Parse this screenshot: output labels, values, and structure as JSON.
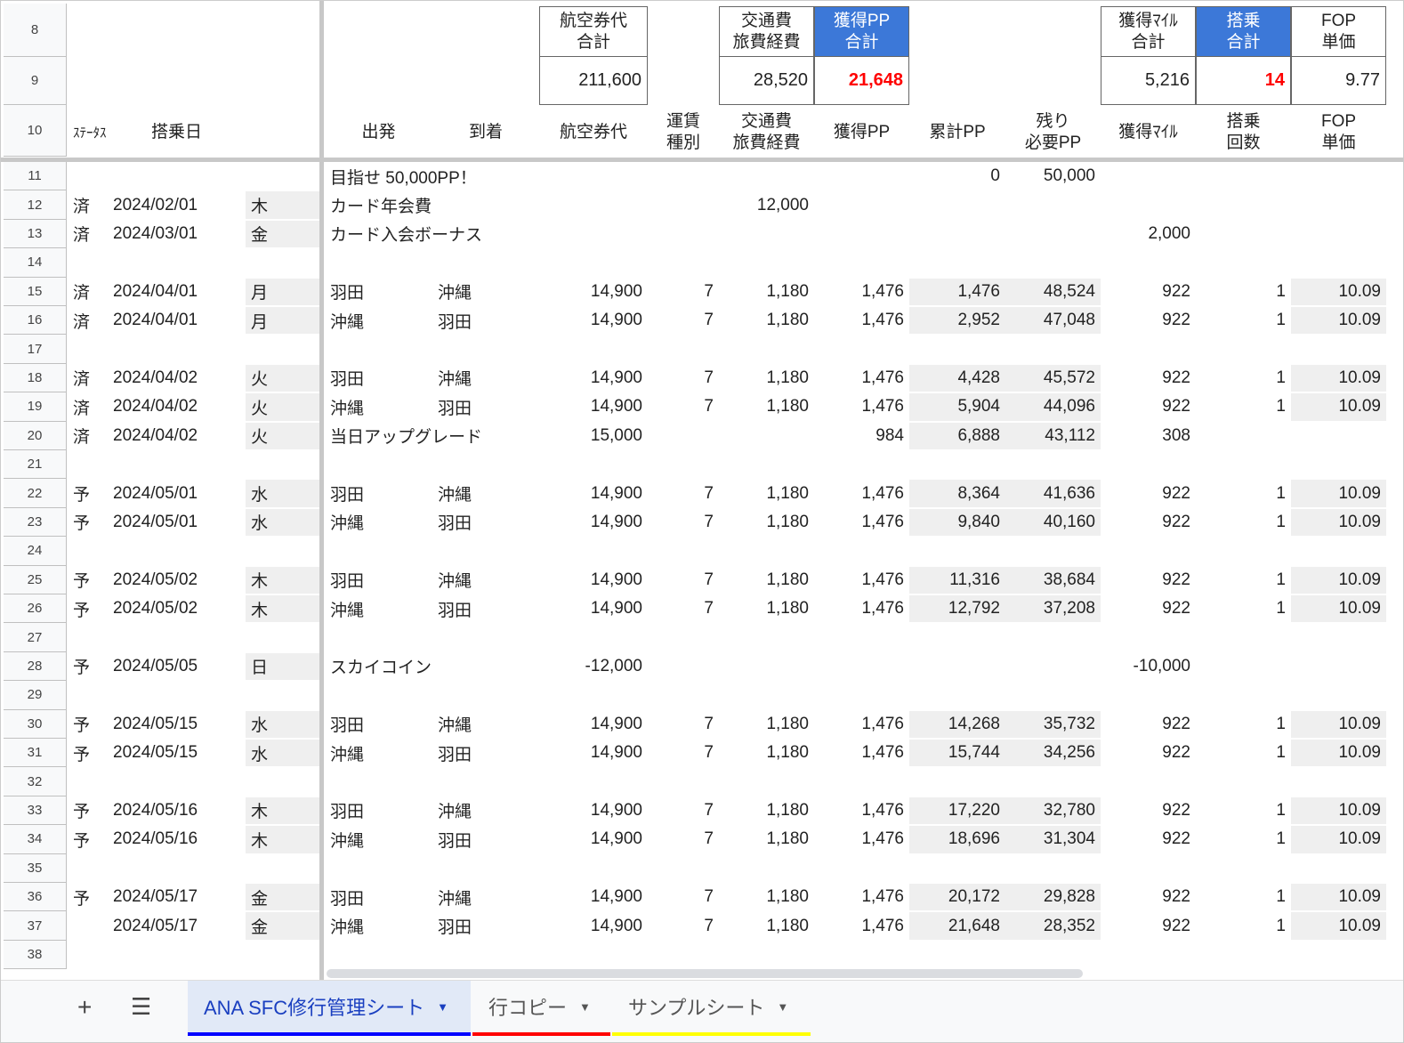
{
  "summary": {
    "fare_total": {
      "label": "航空券代\n合計",
      "value": "211,600"
    },
    "transport_total": {
      "label": "交通費\n旅費経費",
      "value": "28,520"
    },
    "pp_total": {
      "label": "獲得PP\n合計",
      "value": "21,648"
    },
    "miles_total": {
      "label": "獲得ﾏｲﾙ\n合計",
      "value": "5,216"
    },
    "boarding_total": {
      "label": "搭乗\n合計",
      "value": "14"
    },
    "fop_unit": {
      "label": "FOP\n単価",
      "value": "9.77"
    }
  },
  "headers": {
    "status": "ｽﾃｰﾀｽ",
    "date": "搭乗日",
    "dep": "出発",
    "arr": "到着",
    "fare": "航空券代",
    "type": "運賃\n種別",
    "transport": "交通費\n旅費経費",
    "pp": "獲得PP",
    "cum": "累計PP",
    "remain": "残り\n必要PP",
    "miles": "獲得ﾏｲﾙ",
    "count": "搭乗\n回数",
    "fop": "FOP\n単価"
  },
  "header_row_numbers": [
    "8",
    "9",
    "10"
  ],
  "rows": [
    {
      "n": "11",
      "dep": "目指せ 50,000PP！",
      "cum": "0",
      "remain": "50,000"
    },
    {
      "n": "12",
      "status": "済",
      "date": "2024/02/01",
      "dow": "木",
      "dep": "カード年会費",
      "transport": "12,000"
    },
    {
      "n": "13",
      "status": "済",
      "date": "2024/03/01",
      "dow": "金",
      "dep": "カード入会ボーナス",
      "miles": "2,000"
    },
    {
      "n": "14"
    },
    {
      "n": "15",
      "status": "済",
      "date": "2024/04/01",
      "dow": "月",
      "dep": "羽田",
      "arr": "沖縄",
      "fare": "14,900",
      "type": "7",
      "transport": "1,180",
      "pp": "1,476",
      "cum": "1,476",
      "remain": "48,524",
      "miles": "922",
      "count": "1",
      "fop": "10.09"
    },
    {
      "n": "16",
      "status": "済",
      "date": "2024/04/01",
      "dow": "月",
      "dep": "沖縄",
      "arr": "羽田",
      "fare": "14,900",
      "type": "7",
      "transport": "1,180",
      "pp": "1,476",
      "cum": "2,952",
      "remain": "47,048",
      "miles": "922",
      "count": "1",
      "fop": "10.09"
    },
    {
      "n": "17"
    },
    {
      "n": "18",
      "status": "済",
      "date": "2024/04/02",
      "dow": "火",
      "dep": "羽田",
      "arr": "沖縄",
      "fare": "14,900",
      "type": "7",
      "transport": "1,180",
      "pp": "1,476",
      "cum": "4,428",
      "remain": "45,572",
      "miles": "922",
      "count": "1",
      "fop": "10.09"
    },
    {
      "n": "19",
      "status": "済",
      "date": "2024/04/02",
      "dow": "火",
      "dep": "沖縄",
      "arr": "羽田",
      "fare": "14,900",
      "type": "7",
      "transport": "1,180",
      "pp": "1,476",
      "cum": "5,904",
      "remain": "44,096",
      "miles": "922",
      "count": "1",
      "fop": "10.09"
    },
    {
      "n": "20",
      "status": "済",
      "date": "2024/04/02",
      "dow": "火",
      "dep": "当日アップグレード",
      "fare": "15,000",
      "pp": "984",
      "cum": "6,888",
      "remain": "43,112",
      "miles": "308"
    },
    {
      "n": "21"
    },
    {
      "n": "22",
      "status": "予",
      "date": "2024/05/01",
      "dow": "水",
      "dep": "羽田",
      "arr": "沖縄",
      "fare": "14,900",
      "type": "7",
      "transport": "1,180",
      "pp": "1,476",
      "cum": "8,364",
      "remain": "41,636",
      "miles": "922",
      "count": "1",
      "fop": "10.09"
    },
    {
      "n": "23",
      "status": "予",
      "date": "2024/05/01",
      "dow": "水",
      "dep": "沖縄",
      "arr": "羽田",
      "fare": "14,900",
      "type": "7",
      "transport": "1,180",
      "pp": "1,476",
      "cum": "9,840",
      "remain": "40,160",
      "miles": "922",
      "count": "1",
      "fop": "10.09"
    },
    {
      "n": "24"
    },
    {
      "n": "25",
      "status": "予",
      "date": "2024/05/02",
      "dow": "木",
      "dep": "羽田",
      "arr": "沖縄",
      "fare": "14,900",
      "type": "7",
      "transport": "1,180",
      "pp": "1,476",
      "cum": "11,316",
      "remain": "38,684",
      "miles": "922",
      "count": "1",
      "fop": "10.09"
    },
    {
      "n": "26",
      "status": "予",
      "date": "2024/05/02",
      "dow": "木",
      "dep": "沖縄",
      "arr": "羽田",
      "fare": "14,900",
      "type": "7",
      "transport": "1,180",
      "pp": "1,476",
      "cum": "12,792",
      "remain": "37,208",
      "miles": "922",
      "count": "1",
      "fop": "10.09"
    },
    {
      "n": "27"
    },
    {
      "n": "28",
      "status": "予",
      "date": "2024/05/05",
      "dow": "日",
      "dep": "スカイコイン",
      "fare": "-12,000",
      "miles": "-10,000"
    },
    {
      "n": "29"
    },
    {
      "n": "30",
      "status": "予",
      "date": "2024/05/15",
      "dow": "水",
      "dep": "羽田",
      "arr": "沖縄",
      "fare": "14,900",
      "type": "7",
      "transport": "1,180",
      "pp": "1,476",
      "cum": "14,268",
      "remain": "35,732",
      "miles": "922",
      "count": "1",
      "fop": "10.09"
    },
    {
      "n": "31",
      "status": "予",
      "date": "2024/05/15",
      "dow": "水",
      "dep": "沖縄",
      "arr": "羽田",
      "fare": "14,900",
      "type": "7",
      "transport": "1,180",
      "pp": "1,476",
      "cum": "15,744",
      "remain": "34,256",
      "miles": "922",
      "count": "1",
      "fop": "10.09"
    },
    {
      "n": "32"
    },
    {
      "n": "33",
      "status": "予",
      "date": "2024/05/16",
      "dow": "木",
      "dep": "羽田",
      "arr": "沖縄",
      "fare": "14,900",
      "type": "7",
      "transport": "1,180",
      "pp": "1,476",
      "cum": "17,220",
      "remain": "32,780",
      "miles": "922",
      "count": "1",
      "fop": "10.09"
    },
    {
      "n": "34",
      "status": "予",
      "date": "2024/05/16",
      "dow": "木",
      "dep": "沖縄",
      "arr": "羽田",
      "fare": "14,900",
      "type": "7",
      "transport": "1,180",
      "pp": "1,476",
      "cum": "18,696",
      "remain": "31,304",
      "miles": "922",
      "count": "1",
      "fop": "10.09"
    },
    {
      "n": "35"
    },
    {
      "n": "36",
      "status": "予",
      "date": "2024/05/17",
      "dow": "金",
      "dep": "羽田",
      "arr": "沖縄",
      "fare": "14,900",
      "type": "7",
      "transport": "1,180",
      "pp": "1,476",
      "cum": "20,172",
      "remain": "29,828",
      "miles": "922",
      "count": "1",
      "fop": "10.09"
    },
    {
      "n": "37",
      "date": "2024/05/17",
      "dow": "金",
      "dep": "沖縄",
      "arr": "羽田",
      "fare": "14,900",
      "type": "7",
      "transport": "1,180",
      "pp": "1,476",
      "cum": "21,648",
      "remain": "28,352",
      "miles": "922",
      "count": "1",
      "fop": "10.09"
    },
    {
      "n": "38"
    }
  ],
  "tabs": {
    "add_icon": "plus-icon",
    "menu_icon": "hamburger-icon",
    "items": [
      {
        "label": "ANA SFC修行管理シート",
        "color": "#0000ff",
        "active": true
      },
      {
        "label": "行コピー",
        "color": "#ff0000"
      },
      {
        "label": "サンプルシート",
        "color": "#ffff00"
      }
    ]
  },
  "colors": {
    "accent": "#3c78d8",
    "highlight": "#ff0000"
  }
}
